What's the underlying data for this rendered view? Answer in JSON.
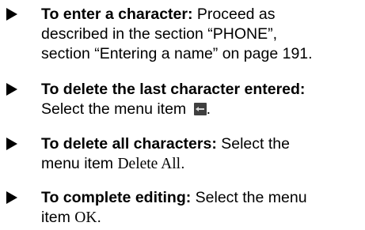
{
  "items": [
    {
      "heading": "To enter a character:",
      "text_1": " Proceed as",
      "text_2": "described in the section “PHONE”,",
      "text_3": "section “Entering a name” on page 191."
    },
    {
      "heading": "To delete the last character entered:",
      "text_1": "Select the menu item ",
      "icon": "delete-last-character-icon",
      "text_2": "."
    },
    {
      "heading": "To delete all characters:",
      "text_1": " Select the",
      "text_2": "menu item ",
      "menu_item": "Delete All",
      "text_3": "."
    },
    {
      "heading": "To complete editing:",
      "text_1": " Select the menu",
      "text_2": "item ",
      "menu_item": "OK",
      "text_3": "."
    }
  ]
}
